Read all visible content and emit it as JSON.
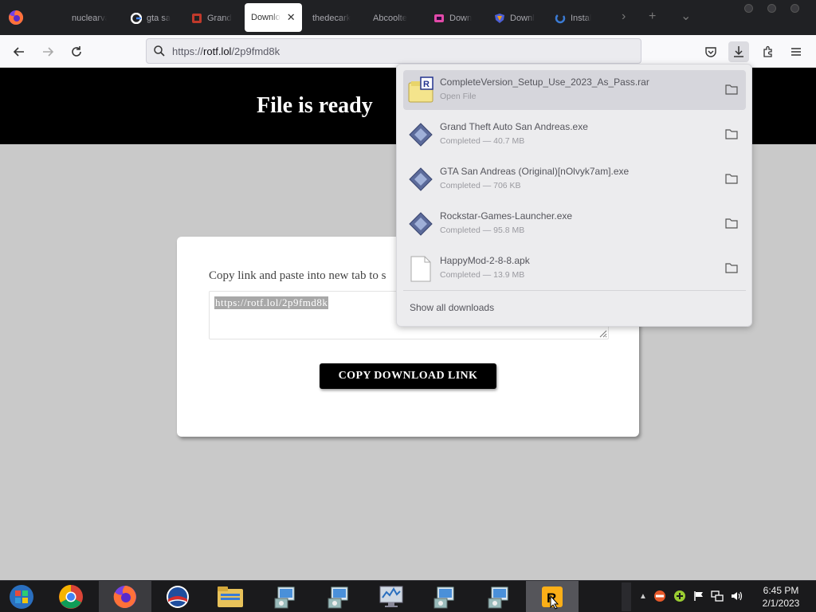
{
  "browser": {
    "tabs": [
      {
        "label": "nuclearva",
        "icon": "blank-tab-icon"
      },
      {
        "label": "gta sa",
        "icon": "google-icon"
      },
      {
        "label": "Grand",
        "icon": "game-site-icon"
      },
      {
        "label": "Downlo",
        "icon": "none",
        "active": true
      },
      {
        "label": "thedecark",
        "icon": "none"
      },
      {
        "label": "Abcoolte",
        "icon": "none"
      },
      {
        "label": "Down",
        "icon": "download-site-icon"
      },
      {
        "label": "Downl",
        "icon": "shield-site-icon"
      },
      {
        "label": "Instal",
        "icon": "spinner-site-icon"
      }
    ],
    "url": {
      "prefix": "https://",
      "host": "rotf.lol",
      "path": "/2p9fmd8k"
    }
  },
  "page": {
    "banner_title": "File is ready",
    "card": {
      "instruction": "Copy link and paste into new tab to s",
      "link_value": "https://rotf.lol/2p9fmd8k",
      "copy_button": "COPY DOWNLOAD LINK"
    }
  },
  "downloads": {
    "items": [
      {
        "name": "CompleteVersion_Setup_Use_2023_As_Pass.rar",
        "status": "Open File",
        "icon": "rar-archive-icon"
      },
      {
        "name": "Grand Theft Auto San Andreas.exe",
        "status": "Completed — 40.7 MB",
        "icon": "exe-file-icon"
      },
      {
        "name": "GTA San Andreas (Original)[nOlvyk7am].exe",
        "status": "Completed — 706 KB",
        "icon": "exe-file-icon"
      },
      {
        "name": "Rockstar-Games-Launcher.exe",
        "status": "Completed — 95.8 MB",
        "icon": "exe-file-icon"
      },
      {
        "name": "HappyMod-2-8-8.apk",
        "status": "Completed — 13.9 MB",
        "icon": "apk-file-icon"
      }
    ],
    "show_all": "Show all downloads"
  },
  "taskbar": {
    "apps": [
      "start-orb-icon",
      "chrome-icon",
      "firefox-icon",
      "obama-campaign-icon",
      "file-explorer-icon",
      "installer-icon",
      "installer-icon",
      "resource-monitor-icon",
      "installer-icon",
      "installer-icon",
      "rockstar-icon"
    ],
    "clock": {
      "time": "6:45 PM",
      "date": "2/1/2023"
    }
  },
  "colors": {
    "banner": "#000000",
    "page_bg": "#c9c9c9",
    "taskbar": "#1a1a1c"
  }
}
